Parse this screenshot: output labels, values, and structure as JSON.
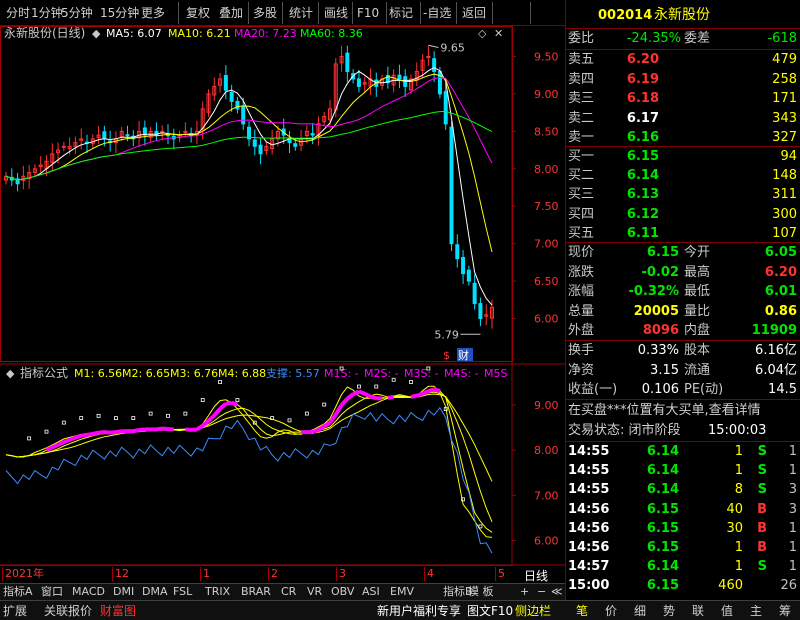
{
  "toolbar": {
    "items": [
      "分时",
      "1分钟",
      "5分钟",
      "15分钟",
      "更多",
      "复权",
      "叠加",
      "多股",
      "统计",
      "画线",
      "F10",
      "标记",
      "-自选",
      "返回"
    ]
  },
  "main_chart": {
    "title": "永新股份(日线)",
    "ma": [
      {
        "label": "MA5: 6.07",
        "color": "#ffffff"
      },
      {
        "label": "MA10: 6.21",
        "color": "#ffff00"
      },
      {
        "label": "MA20: 7.23",
        "color": "#ff00ff"
      },
      {
        "label": "MA60: 8.36",
        "color": "#00ff00"
      }
    ],
    "price_ticks": [
      "9.50",
      "9.00",
      "8.50",
      "8.00",
      "7.50",
      "7.00",
      "6.50",
      "6.00"
    ],
    "high_label": "9.65",
    "low_label": "5.79",
    "marker_s": "$",
    "marker_cai": "财"
  },
  "indicator": {
    "title": "指标公式",
    "items": [
      {
        "label": "M1: 6.56",
        "color": "#ffff00"
      },
      {
        "label": "M2: 6.65",
        "color": "#ffff00"
      },
      {
        "label": "M3: 6.76",
        "color": "#ffff00"
      },
      {
        "label": "M4: 6.88",
        "color": "#ffff00"
      },
      {
        "label": "支撑: 5.57",
        "color": "#3c8cff"
      },
      {
        "label": "M1S: -",
        "color": "#ff00ff"
      },
      {
        "label": "M2S: -",
        "color": "#ff00ff"
      },
      {
        "label": "M3S: -",
        "color": "#ff00ff"
      },
      {
        "label": "M4S: -",
        "color": "#ff00ff"
      },
      {
        "label": "M5S",
        "color": "#ff00ff"
      }
    ],
    "ticks": [
      "9.00",
      "8.00",
      "7.00",
      "6.00"
    ]
  },
  "xaxis": {
    "labels": [
      "2021年",
      "12",
      "1",
      "2",
      "3",
      "4",
      "5"
    ],
    "period": "日线"
  },
  "bottom_tabs": [
    "指标A",
    "窗口",
    "MACD",
    "DMI",
    "DMA",
    "FSL",
    "TRIX",
    "BRAR",
    "CR",
    "VR",
    "OBV",
    "ASI",
    "EMV",
    "指标B",
    "模 板",
    "+",
    "−",
    "≪"
  ],
  "bottom_bar": {
    "left": [
      "扩展",
      "关联报价",
      "财富图"
    ],
    "right": [
      "新用户福利专享",
      "图文F10",
      "侧边栏"
    ]
  },
  "quote": {
    "code": "002014",
    "name": "永新股份",
    "weibi_label": "委比",
    "weibi": "-24.35%",
    "weicha_label": "委差",
    "weicha": "-618",
    "sells": [
      {
        "label": "卖五",
        "price": "6.20",
        "vol": "479"
      },
      {
        "label": "卖四",
        "price": "6.19",
        "vol": "258"
      },
      {
        "label": "卖三",
        "price": "6.18",
        "vol": "171"
      },
      {
        "label": "卖二",
        "price": "6.17",
        "vol": "343"
      },
      {
        "label": "卖一",
        "price": "6.16",
        "vol": "327"
      }
    ],
    "buys": [
      {
        "label": "买一",
        "price": "6.15",
        "vol": "94"
      },
      {
        "label": "买二",
        "price": "6.14",
        "vol": "148"
      },
      {
        "label": "买三",
        "price": "6.13",
        "vol": "311"
      },
      {
        "label": "买四",
        "price": "6.12",
        "vol": "300"
      },
      {
        "label": "买五",
        "price": "6.11",
        "vol": "107"
      }
    ],
    "stats": [
      {
        "l1": "现价",
        "v1": "6.15",
        "c1": "green",
        "l2": "今开",
        "v2": "6.05",
        "c2": "green"
      },
      {
        "l1": "涨跌",
        "v1": "-0.02",
        "c1": "green",
        "l2": "最高",
        "v2": "6.20",
        "c2": "red"
      },
      {
        "l1": "涨幅",
        "v1": "-0.32%",
        "c1": "green",
        "l2": "最低",
        "v2": "6.01",
        "c2": "green"
      },
      {
        "l1": "总量",
        "v1": "20005",
        "c1": "yellow",
        "l2": "量比",
        "v2": "0.86",
        "c2": "yellow"
      },
      {
        "l1": "外盘",
        "v1": "8096",
        "c1": "red",
        "l2": "内盘",
        "v2": "11909",
        "c2": "green"
      }
    ],
    "stats2": [
      {
        "l1": "换手",
        "v1": "0.33%",
        "l2": "股本",
        "v2": "6.16亿"
      },
      {
        "l1": "净资",
        "v1": "3.15",
        "l2": "流通",
        "v2": "6.04亿"
      },
      {
        "l1": "收益(一)",
        "v1": "0.106",
        "l2": "PE(动)",
        "v2": "14.5"
      }
    ],
    "notice": "在买盘***位置有大买单,查看详情",
    "status_label": "交易状态: 闭市阶段",
    "status_time": "15:00:03",
    "ticks": [
      {
        "time": "14:55",
        "price": "6.14",
        "vol": "1",
        "side": "S",
        "n": "1"
      },
      {
        "time": "14:55",
        "price": "6.14",
        "vol": "1",
        "side": "S",
        "n": "1"
      },
      {
        "time": "14:55",
        "price": "6.14",
        "vol": "8",
        "side": "S",
        "n": "3"
      },
      {
        "time": "14:56",
        "price": "6.15",
        "vol": "40",
        "side": "B",
        "n": "3"
      },
      {
        "time": "14:56",
        "price": "6.15",
        "vol": "30",
        "side": "B",
        "n": "1"
      },
      {
        "time": "14:56",
        "price": "6.15",
        "vol": "1",
        "side": "B",
        "n": "1"
      },
      {
        "time": "14:57",
        "price": "6.14",
        "vol": "1",
        "side": "S",
        "n": "1"
      },
      {
        "time": "15:00",
        "price": "6.15",
        "vol": "460",
        "side": "",
        "n": "26"
      }
    ],
    "tabs": [
      "笔",
      "价",
      "细",
      "势",
      "联",
      "值",
      "主",
      "筹"
    ]
  },
  "chart_data": {
    "type": "candlestick",
    "period": "daily",
    "price_range": [
      5.7,
      9.8
    ],
    "indicator_range": [
      5.5,
      9.6
    ],
    "closes": [
      7.9,
      7.85,
      7.8,
      7.9,
      7.95,
      8.0,
      8.05,
      8.1,
      8.2,
      8.25,
      8.3,
      8.3,
      8.35,
      8.4,
      8.35,
      8.4,
      8.45,
      8.4,
      8.35,
      8.4,
      8.5,
      8.45,
      8.4,
      8.5,
      8.45,
      8.5,
      8.45,
      8.5,
      8.45,
      8.4,
      8.45,
      8.5,
      8.45,
      8.5,
      8.8,
      9.0,
      9.1,
      9.2,
      9.05,
      8.9,
      8.8,
      8.6,
      8.4,
      8.3,
      8.2,
      8.3,
      8.4,
      8.5,
      8.45,
      8.35,
      8.3,
      8.4,
      8.5,
      8.45,
      8.6,
      8.7,
      8.8,
      9.4,
      9.5,
      9.3,
      9.2,
      9.1,
      9.15,
      9.2,
      9.1,
      9.2,
      9.15,
      9.25,
      9.2,
      9.1,
      9.2,
      9.3,
      9.45,
      9.5,
      9.3,
      9.0,
      8.6,
      7.0,
      6.8,
      6.6,
      6.5,
      6.2,
      6.0,
      6.05,
      6.15
    ],
    "ma5_last": 6.07,
    "ma10_last": 6.21,
    "ma20_last": 7.23,
    "ma60_last": 8.36,
    "high": 9.65,
    "low": 5.79
  }
}
